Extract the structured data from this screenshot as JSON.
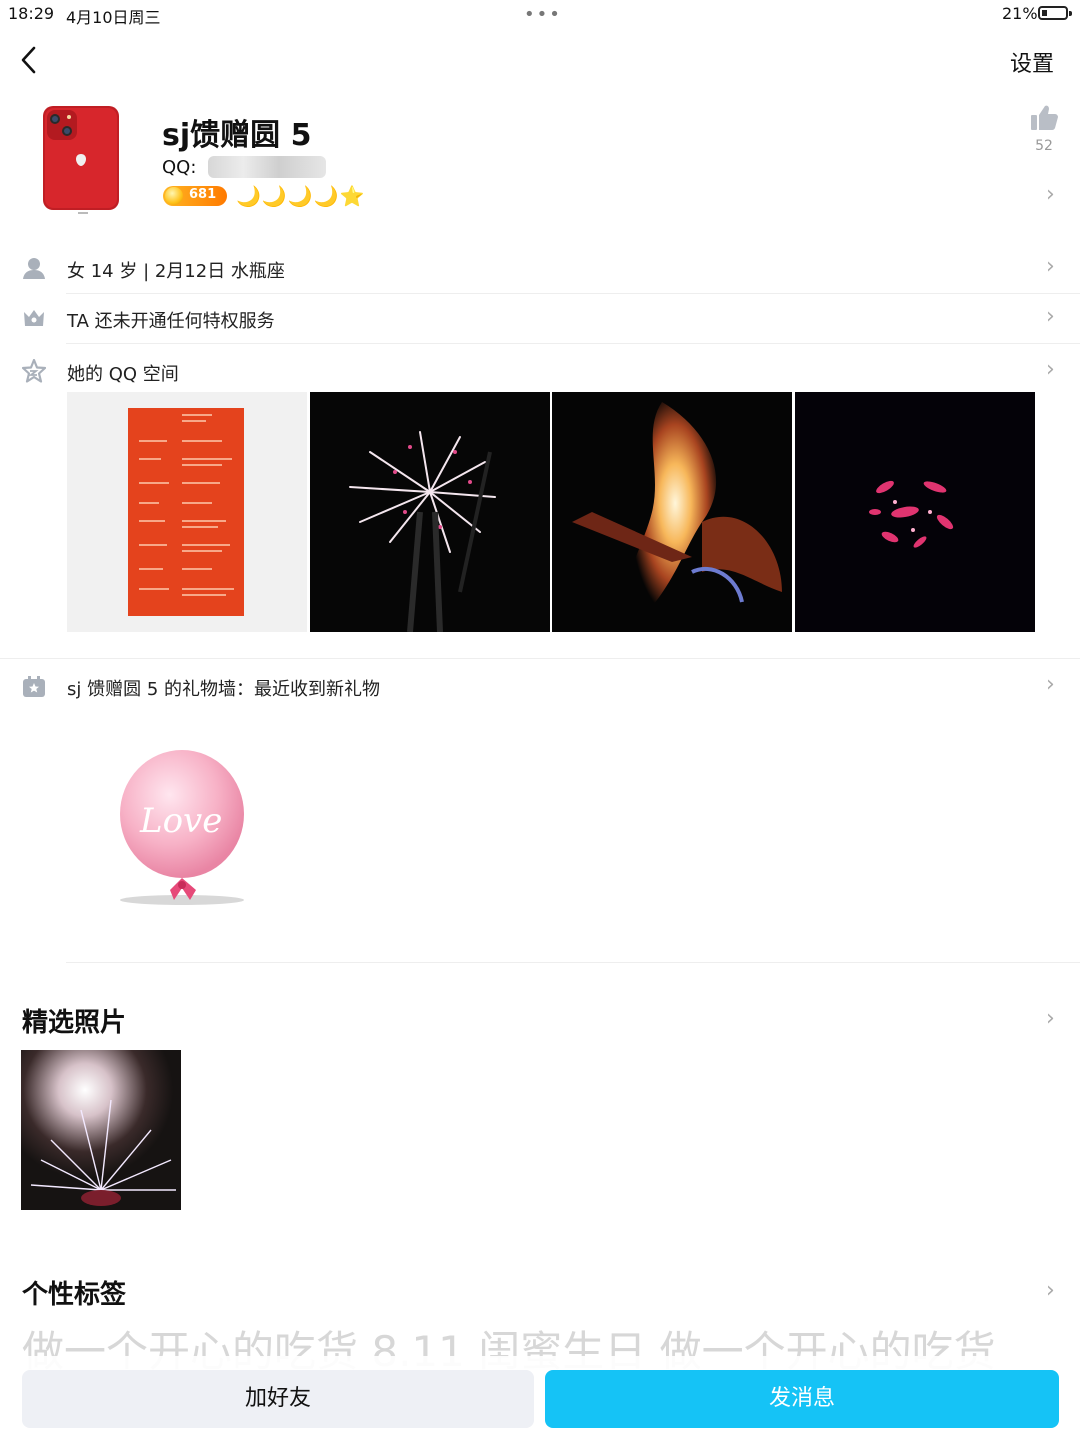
{
  "status_bar": {
    "time": "18:29",
    "date": "4月10日周三",
    "dots": "•••",
    "battery_percent": "21%",
    "battery_level": 0.21
  },
  "nav": {
    "back_icon": "chevron-left-icon",
    "settings_label": "设置"
  },
  "profile": {
    "nickname": "sj馈赠圆 5",
    "qq_label": "QQ:",
    "level": "681",
    "moons": "🌙🌙🌙🌙⭐",
    "likes": "52",
    "chevron": "›"
  },
  "rows": {
    "info": {
      "text": "女 14 岁 | 2月12日 水瓶座",
      "icon": "person-icon"
    },
    "privilege": {
      "text": "TA 还未开通任何特权服务",
      "icon": "crown-icon"
    },
    "qzone": {
      "text": "她的 QQ 空间",
      "icon": "star-icon"
    },
    "gift_wall": {
      "text": "sj 馈赠圆 5 的礼物墙：最近收到新礼物",
      "icon": "gift-icon"
    },
    "chevron": "›"
  },
  "gift": {
    "name": "love balloon",
    "text": "Love"
  },
  "sections": {
    "featured_title": "精选照片",
    "tags_title": "个性标签",
    "tags_text": "做一个开心的吃货 8.11 闺蜜生日 做一个开心的吃货"
  },
  "bottom": {
    "add_friend": "加好友",
    "send_message": "发消息"
  },
  "colors": {
    "accent": "#15c3f6",
    "level_badge": "#ff8c00",
    "secondary_button": "#eef0f5"
  }
}
